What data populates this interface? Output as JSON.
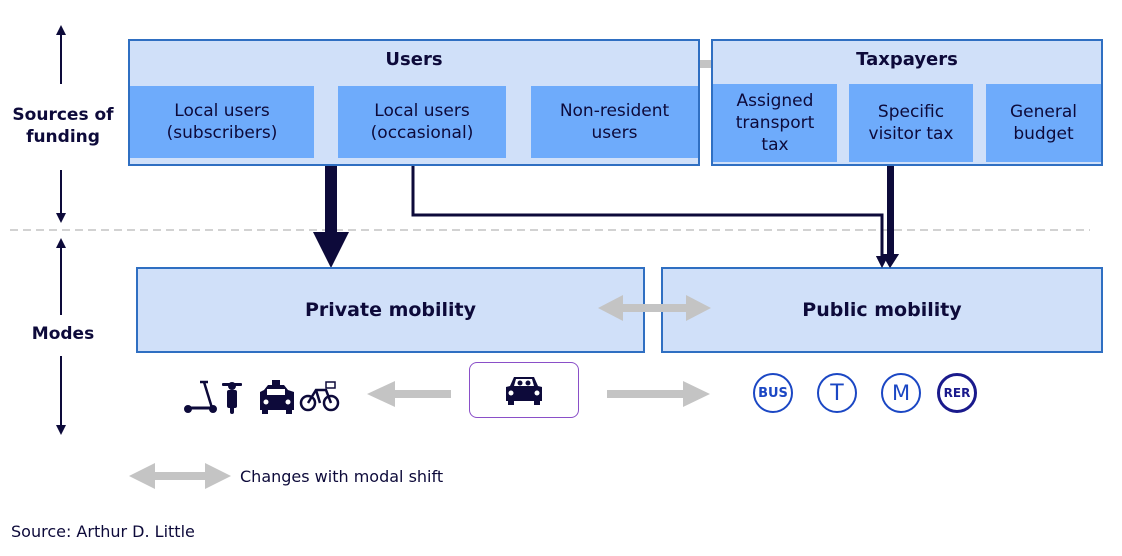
{
  "axis": {
    "sources_label": "Sources of\nfunding",
    "modes_label": "Modes"
  },
  "users": {
    "title": "Users",
    "items": [
      "Local users\n(subscribers)",
      "Local users\n(occasional)",
      "Non-resident\nusers"
    ]
  },
  "taxpayers": {
    "title": "Taxpayers",
    "items": [
      "Assigned\ntransport\ntax",
      "Specific\nvisitor tax",
      "General\nbudget"
    ]
  },
  "modes": {
    "private": "Private mobility",
    "public": "Public mobility"
  },
  "private_icons": [
    "kick-scooter-icon",
    "moped-icon",
    "taxi-icon",
    "bicycle-icon"
  ],
  "car_icon": "car-icon",
  "public_icons": [
    {
      "name": "bus-icon",
      "label": "BUS"
    },
    {
      "name": "tram-icon",
      "label": "T"
    },
    {
      "name": "metro-icon",
      "label": "M"
    },
    {
      "name": "rer-icon",
      "label": "RER"
    }
  ],
  "legend": {
    "label": "Changes with modal shift"
  },
  "source": "Source: Arthur D. Little",
  "colors": {
    "navy": "#0d0a3a",
    "group_fill": "#d0e0f9",
    "sub_fill": "#6eabfb",
    "border_blue": "#2f6fc2",
    "grey_arrow": "#c4c4c4",
    "car_border": "#8a4fc8",
    "transit_blue": "#1b47c4"
  }
}
